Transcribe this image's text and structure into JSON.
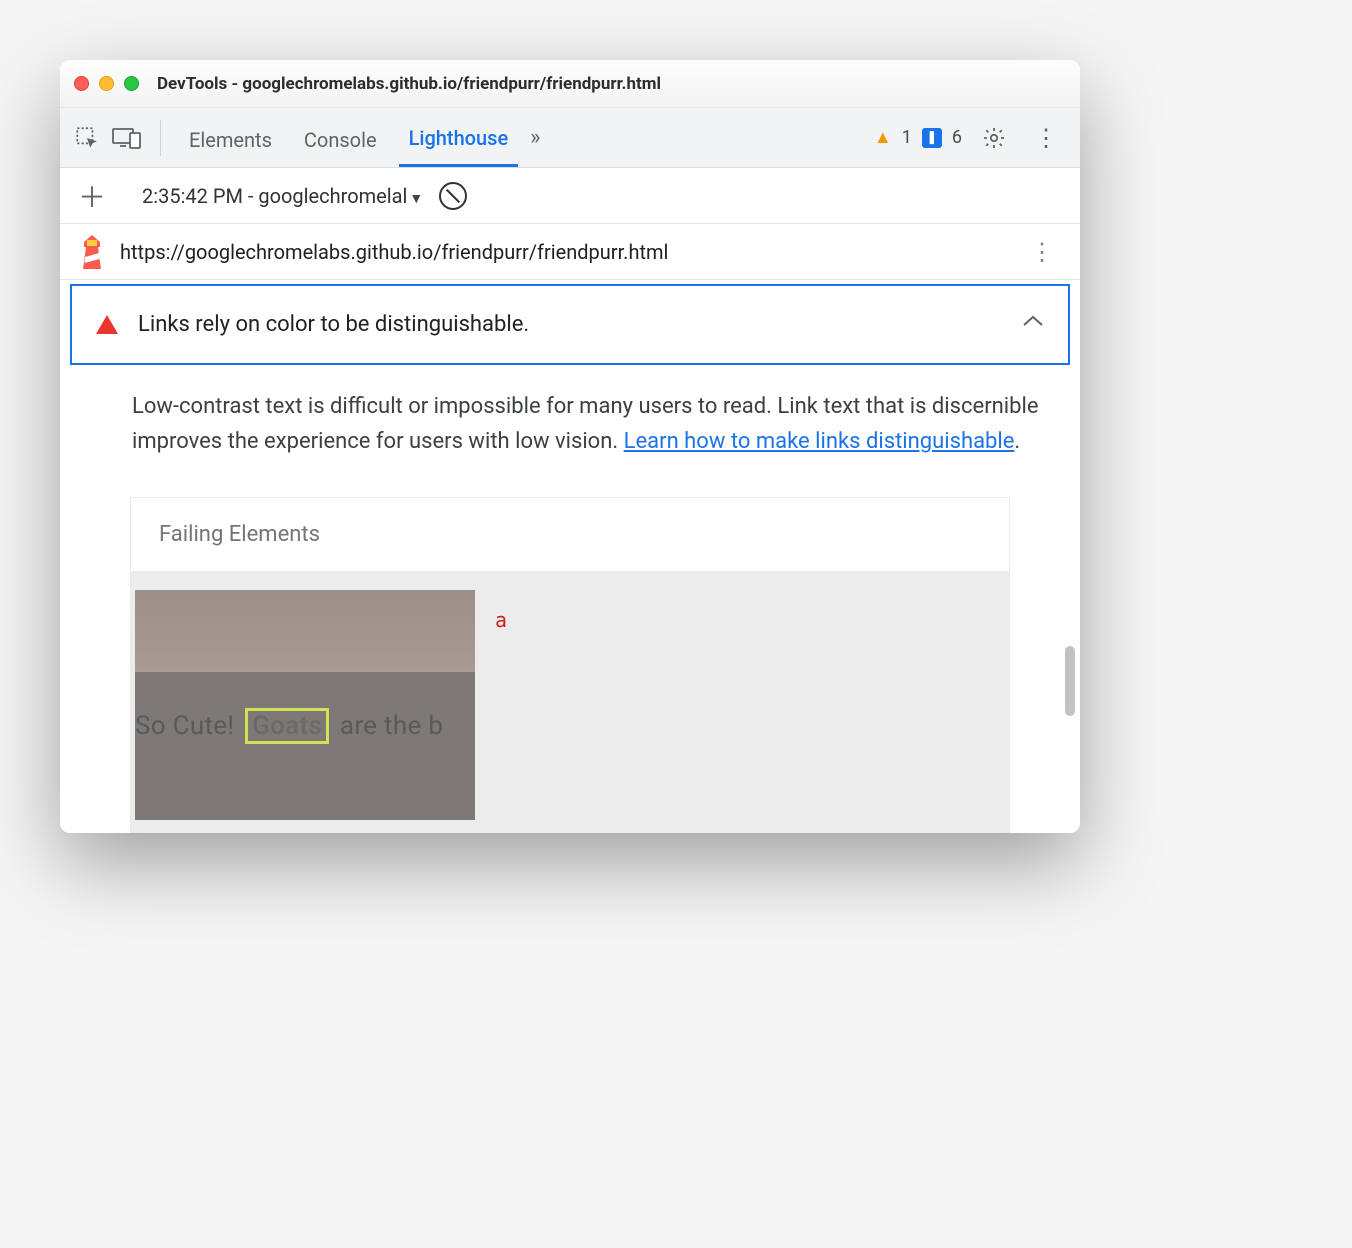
{
  "window": {
    "title": "DevTools - googlechromelabs.github.io/friendpurr/friendpurr.html"
  },
  "tabs": {
    "elements": "Elements",
    "console": "Console",
    "lighthouse": "Lighthouse",
    "overflow": "»"
  },
  "badges": {
    "warn_count": "1",
    "msg_count": "6"
  },
  "report_selector": {
    "label": "2:35:42 PM - googlechromelal"
  },
  "url_bar": {
    "url": "https://googlechromelabs.github.io/friendpurr/friendpurr.html"
  },
  "audit": {
    "title": "Links rely on color to be distinguishable.",
    "desc_prefix": "Low-contrast text is difficult or impossible for many users to read. Link text that is discernible improves the experience for users with low vision. ",
    "learn_link": "Learn how to make links distinguishable",
    "desc_suffix": "."
  },
  "failing": {
    "heading": "Failing Elements",
    "element_tag": "a",
    "snapshot_text_before": "So Cute! ",
    "snapshot_highlight": "Goats",
    "snapshot_text_after": " are the b"
  }
}
